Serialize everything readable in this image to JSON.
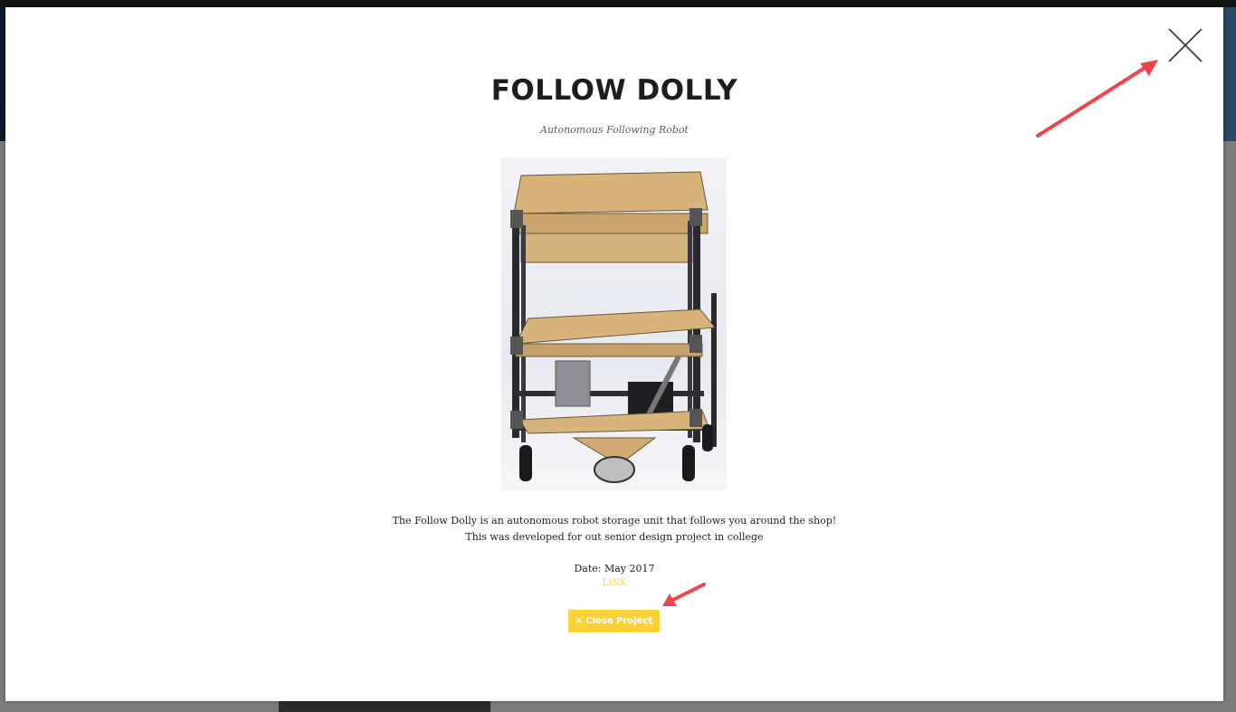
{
  "modal": {
    "title": "FOLLOW DOLLY",
    "subtitle": "Autonomous Following Robot",
    "description": "The Follow Dolly is an autonomous robot storage unit that follows you around the shop! This was developed for out senior design project in college",
    "date": "Date: May 2017",
    "link_label": "LINK",
    "close_button_icon": "×",
    "close_button_label": "Close Project",
    "close_x_icon": "close-icon"
  },
  "colors": {
    "accent": "#fed136",
    "annotation_arrow": "#f0444a",
    "title": "#1d1d1d"
  }
}
